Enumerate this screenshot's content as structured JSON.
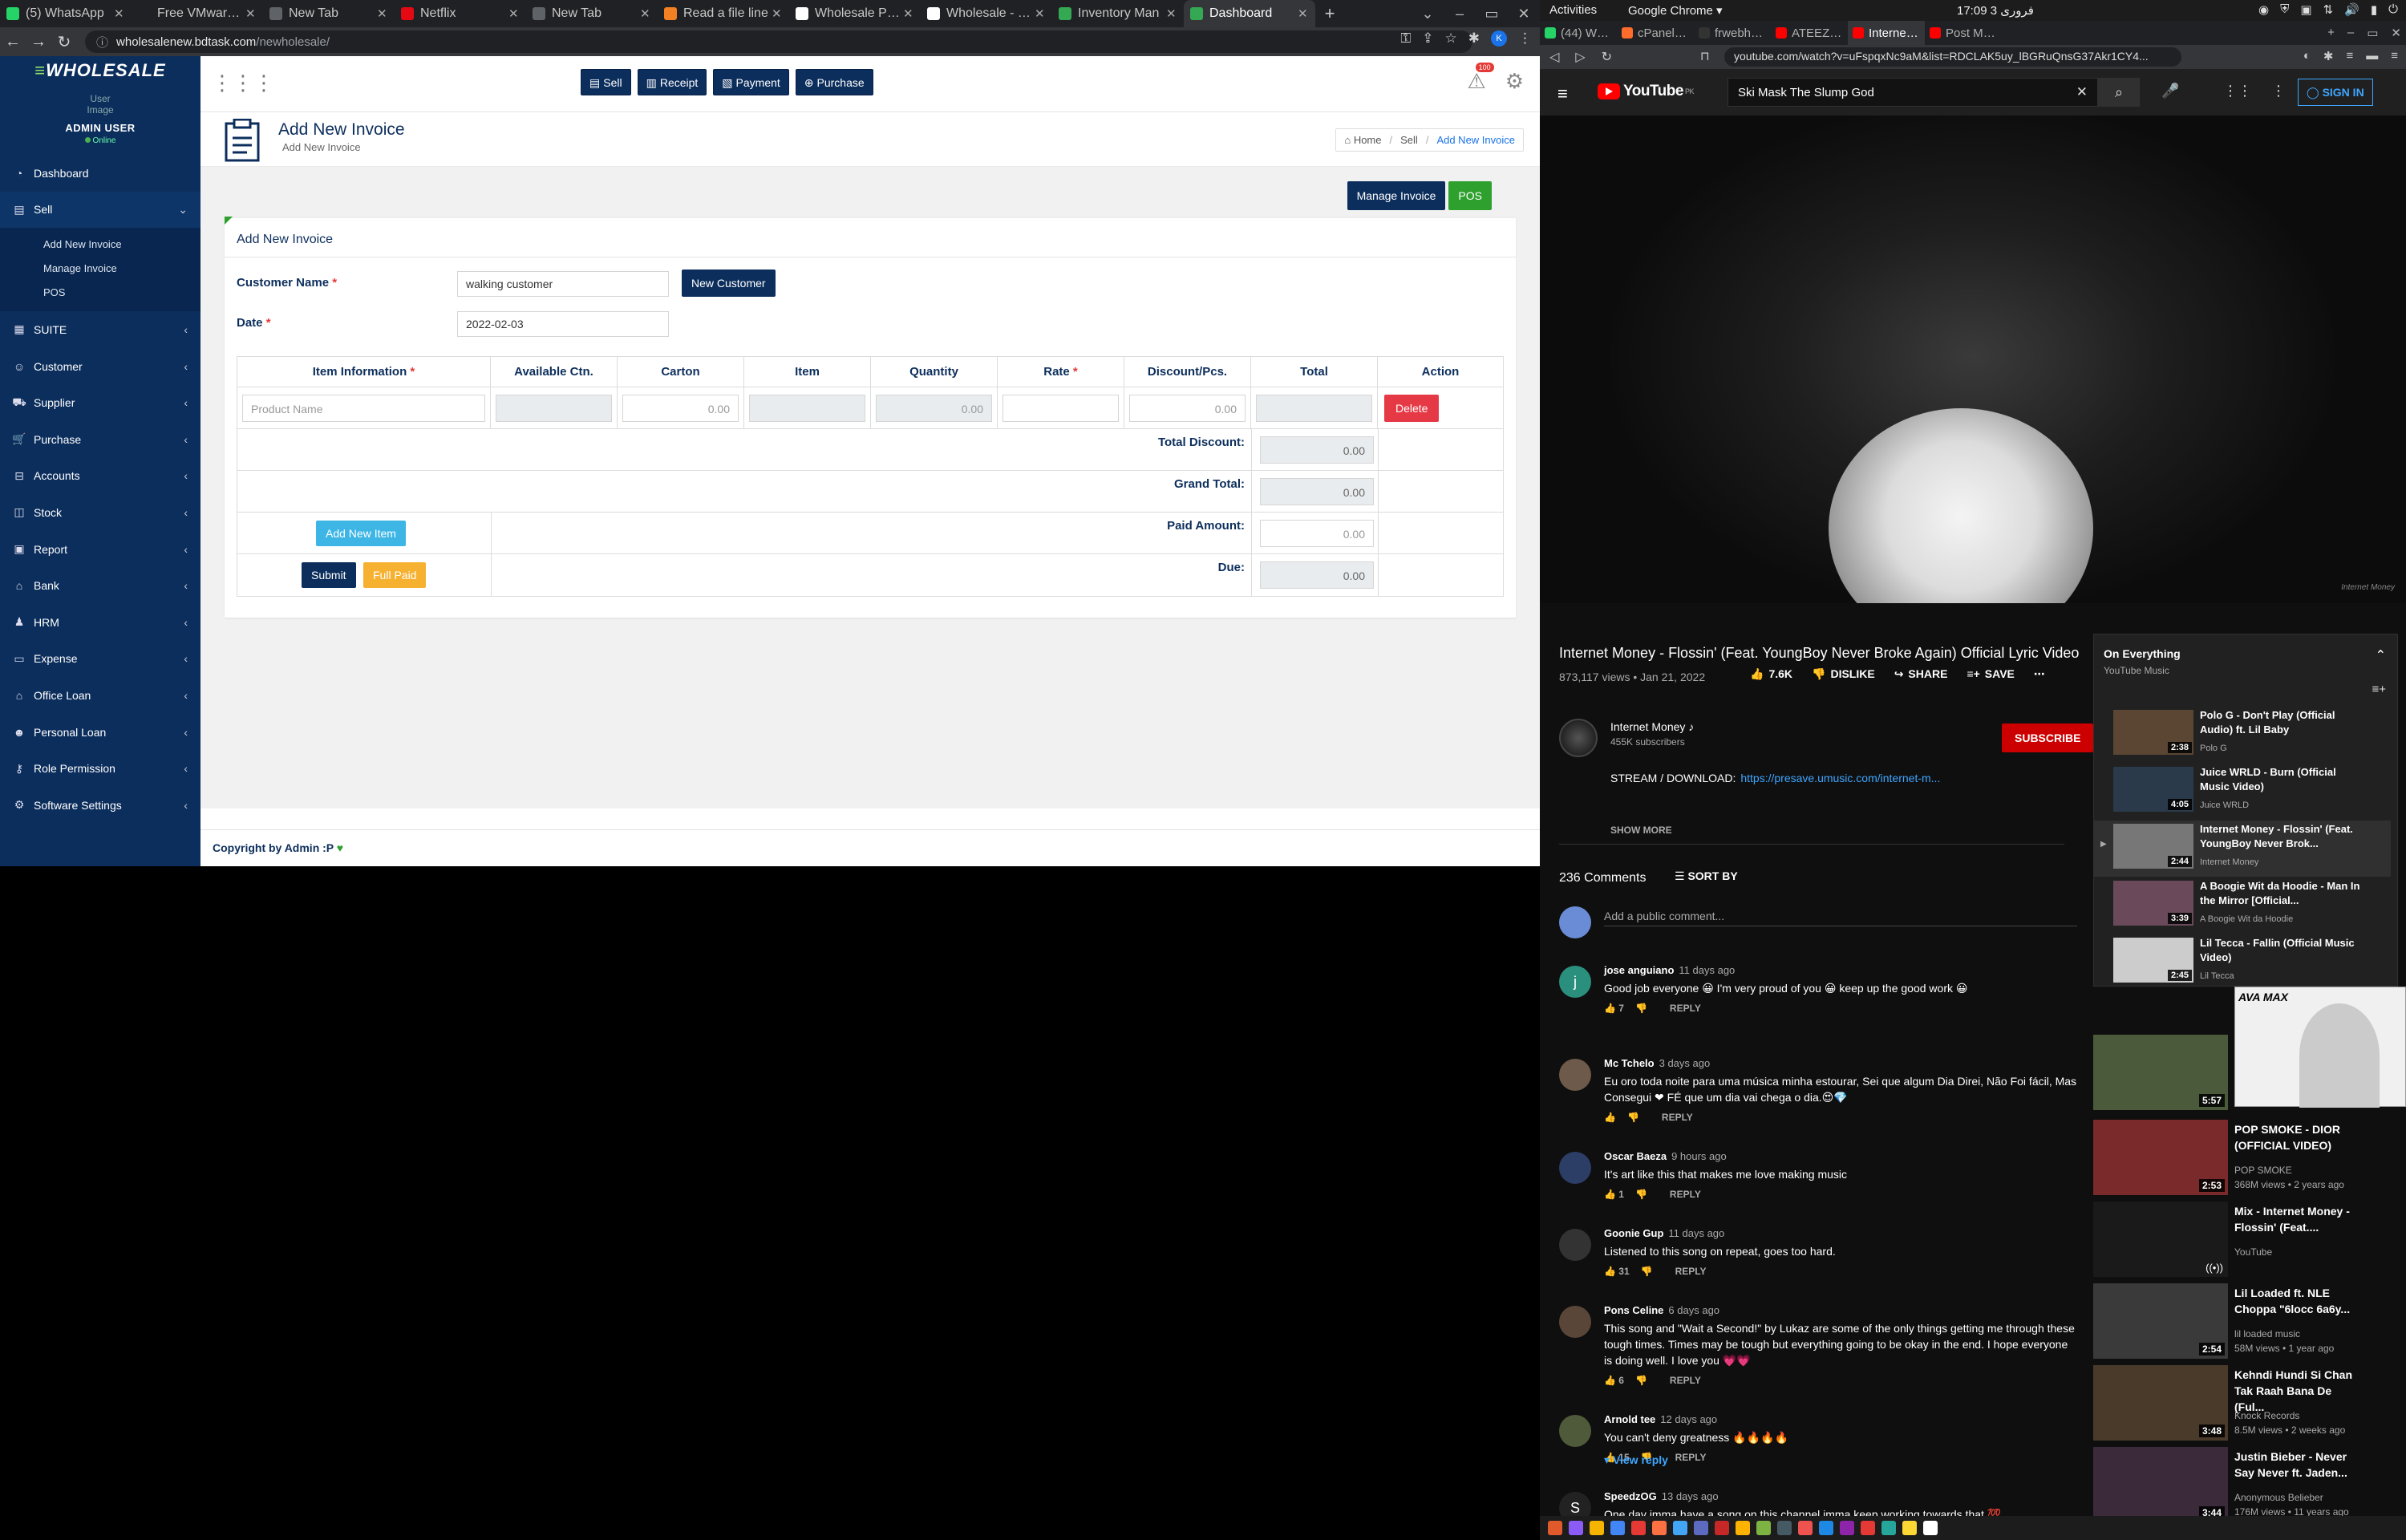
{
  "left_browser": {
    "tabs": [
      {
        "title": "(5) WhatsApp",
        "color": "#25d366",
        "active": false
      },
      {
        "title": "Free VMware V",
        "color": "#202124",
        "active": false
      },
      {
        "title": "New Tab",
        "color": "#5f6368",
        "active": false
      },
      {
        "title": "Netflix",
        "color": "#e50914",
        "active": false
      },
      {
        "title": "New Tab",
        "color": "#5f6368",
        "active": false
      },
      {
        "title": "Read a file line",
        "color": "#f48024",
        "active": false
      },
      {
        "title": "Wholesale PHP",
        "color": "#ffffff",
        "active": false
      },
      {
        "title": "Wholesale - Inv",
        "color": "#ffffff",
        "active": false
      },
      {
        "title": "Inventory Man",
        "color": "#34a853",
        "active": false
      },
      {
        "title": "Dashboard",
        "color": "#34a853",
        "active": true
      }
    ],
    "url_host": "wholesalenew.bdtask.com",
    "url_path": "/newholesale/",
    "profile_initial": "K"
  },
  "app": {
    "logo_prefix": "≡",
    "logo_text": "WHOLESALE",
    "user_avatar_alt": "User Image",
    "user_name": "ADMIN USER",
    "user_status": "Online",
    "sidebar": {
      "dashboard": "Dashboard",
      "sell": "Sell",
      "sell_sub": [
        "Add New Invoice",
        "Manage Invoice",
        "POS"
      ],
      "items": [
        "SUITE",
        "Customer",
        "Supplier",
        "Purchase",
        "Accounts",
        "Stock",
        "Report",
        "Bank",
        "HRM",
        "Expense",
        "Office Loan",
        "Personal Loan",
        "Role Permission",
        "Software Settings"
      ]
    },
    "topnav": {
      "sell": "Sell",
      "receipt": "Receipt",
      "payment": "Payment",
      "purchase": "Purchase",
      "notif_count": "100"
    },
    "page": {
      "title": "Add New Invoice",
      "subtitle": "Add New Invoice",
      "breadcrumb": [
        "Home",
        "Sell",
        "Add New Invoice"
      ]
    },
    "actions": {
      "manage_invoice": "Manage Invoice",
      "pos": "POS"
    },
    "form": {
      "card_title": "Add New Invoice",
      "customer_label": "Customer Name",
      "customer_value": "walking customer",
      "new_customer": "New Customer",
      "date_label": "Date",
      "date_value": "2022-02-03",
      "required_mark": "*"
    },
    "table": {
      "headers": [
        "Item Information",
        "Available Ctn.",
        "Carton",
        "Item",
        "Quantity",
        "Rate",
        "Discount/Pcs.",
        "Total",
        "Action"
      ],
      "product_placeholder": "Product Name",
      "zero": "0.00",
      "delete": "Delete",
      "total_discount": "Total Discount:",
      "grand_total": "Grand Total:",
      "paid_amount": "Paid Amount:",
      "due": "Due:",
      "add_item": "Add New Item",
      "submit": "Submit",
      "full_paid": "Full Paid"
    },
    "footer": "Copyright by Admin :P"
  },
  "gnome": {
    "activities": "Activities",
    "app": "Google Chrome ▾",
    "clock": "17:09  3 فروری"
  },
  "right_browser": {
    "tabs": [
      {
        "title": "(44) WhatsApp",
        "color": "#25d366"
      },
      {
        "title": "cPanel - Main",
        "color": "#ff6c2c"
      },
      {
        "title": "frwebhost.efla",
        "color": "#333"
      },
      {
        "title": "ATEEZ - YouTub",
        "color": "#ff0000"
      },
      {
        "title": "Internet M",
        "color": "#ff0000"
      },
      {
        "title": "Post Malone -",
        "color": "#ff0000"
      }
    ],
    "url": "youtube.com/watch?v=uFspqxNc9aM&list=RDCLAK5uy_lBGRuQnsG37Akr1CY4..."
  },
  "youtube": {
    "logo": "YouTube",
    "country": "PK",
    "search": "Ski Mask The Slump God",
    "signin": "SIGN IN",
    "watermark": "Internet Money",
    "title": "Internet Money - Flossin' (Feat. YoungBoy Never Broke Again) Official Lyric Video",
    "meta": "873,117 views • Jan 21, 2022",
    "likes": "7.6K",
    "dislike": "DISLIKE",
    "share": "SHARE",
    "save": "SAVE",
    "channel": "Internet Money",
    "subscribers": "455K subscribers",
    "subscribe": "SUBSCRIBE",
    "desc_label": "STREAM / DOWNLOAD:",
    "desc_link": "https://presave.umusic.com/internet-m...",
    "show_more": "SHOW MORE",
    "comment_count": "236 Comments",
    "sort_by": "SORT BY",
    "add_comment": "Add a public comment...",
    "reply": "REPLY",
    "view_reply": "View reply",
    "comments": [
      {
        "author": "jose anguiano",
        "time": "11 days ago",
        "text": "Good job everyone 😀 I'm very proud of you 😀 keep up the good work 😀",
        "likes": "7",
        "avatar": "#2a8f7c",
        "initial": "j"
      },
      {
        "author": "Mc Tchelo",
        "time": "3 days ago",
        "text": "Eu oro toda noite para uma música minha estourar, Sei que algum Dia Direi, Não Foi fácil, Mas Consegui ❤ FÉ que um dia vai chega o dia.😍💎",
        "likes": "",
        "avatar": "#6d5a4a",
        "initial": ""
      },
      {
        "author": "Oscar Baeza",
        "time": "9 hours ago",
        "text": "It's art like this that makes me love making music",
        "likes": "1",
        "avatar": "#2c3d66",
        "initial": ""
      },
      {
        "author": "Goonie Gup",
        "time": "11 days ago",
        "text": "Listened to this song on repeat, goes too hard.",
        "likes": "31",
        "avatar": "#333333",
        "initial": ""
      },
      {
        "author": "Pons Celine",
        "time": "6 days ago",
        "text": "This song and \"Wait a Second!\" by Lukaz are some of the only things getting me through these tough times. Times may be tough but everything going to be okay in the end. I hope everyone is doing well. I love you 💗💗",
        "likes": "6",
        "avatar": "#5a4638",
        "initial": ""
      },
      {
        "author": "Arnold tee",
        "time": "12 days ago",
        "text": "You can't deny greatness 🔥🔥🔥🔥",
        "likes": "15",
        "avatar": "#4f5a3a",
        "initial": ""
      },
      {
        "author": "SpeedzOG",
        "time": "13 days ago",
        "text": "One day imma have a song on this channel imma keep working towards that 💯",
        "likes": "",
        "avatar": "#222222",
        "initial": "S"
      }
    ],
    "playlist": {
      "title": "On Everything",
      "subtitle": "YouTube Music",
      "items": [
        {
          "title": "Polo G - Don't Play (Official Audio) ft. Lil Baby",
          "channel": "Polo G",
          "duration": "2:38",
          "color": "#5a4632"
        },
        {
          "title": "Juice WRLD - Burn (Official Music Video)",
          "channel": "Juice WRLD",
          "duration": "4:05",
          "color": "#2a3a4a"
        },
        {
          "title": "Internet Money - Flossin' (Feat. YoungBoy Never Brok...",
          "channel": "Internet Money",
          "duration": "2:44",
          "color": "#777777"
        },
        {
          "title": "A Boogie Wit da Hoodie - Man In the Mirror [Official...",
          "channel": "A Boogie Wit da Hoodie",
          "duration": "3:39",
          "color": "#6a4a5a"
        },
        {
          "title": "Lil Tecca - Fallin (Official Music Video)",
          "channel": "Lil Tecca",
          "duration": "2:45",
          "color": "#cccccc"
        }
      ]
    },
    "recommended": [
      {
        "title": "",
        "channel": "",
        "meta": "",
        "duration": "5:57",
        "color": "#4a5a3a"
      },
      {
        "title": "POP SMOKE - DIOR (OFFICIAL VIDEO)",
        "channel": "POP SMOKE",
        "meta": "368M views • 2 years ago",
        "duration": "2:53",
        "color": "#7a2a2a"
      },
      {
        "title": "Mix - Internet Money - Flossin' (Feat....",
        "channel": "YouTube",
        "meta": "",
        "duration": "",
        "color": "#1a1a1a"
      },
      {
        "title": "Lil Loaded ft. NLE Choppa \"6locc 6a6y...",
        "channel": "lil loaded music",
        "meta": "58M views • 1 year ago",
        "duration": "2:54",
        "color": "#3a3a3a"
      },
      {
        "title": "Kehndi Hundi Si Chan Tak Raah Bana De (Ful...",
        "channel": "Knock Records",
        "meta": "8.5M views • 2 weeks ago",
        "duration": "3:48",
        "color": "#4a3a2a"
      },
      {
        "title": "Justin Bieber - Never Say Never ft. Jaden...",
        "channel": "Anonymous Belieber",
        "meta": "176M views • 11 years ago",
        "duration": "3:44",
        "color": "#3a2a3a"
      }
    ],
    "mini_player_text": "AVA  MAX"
  }
}
